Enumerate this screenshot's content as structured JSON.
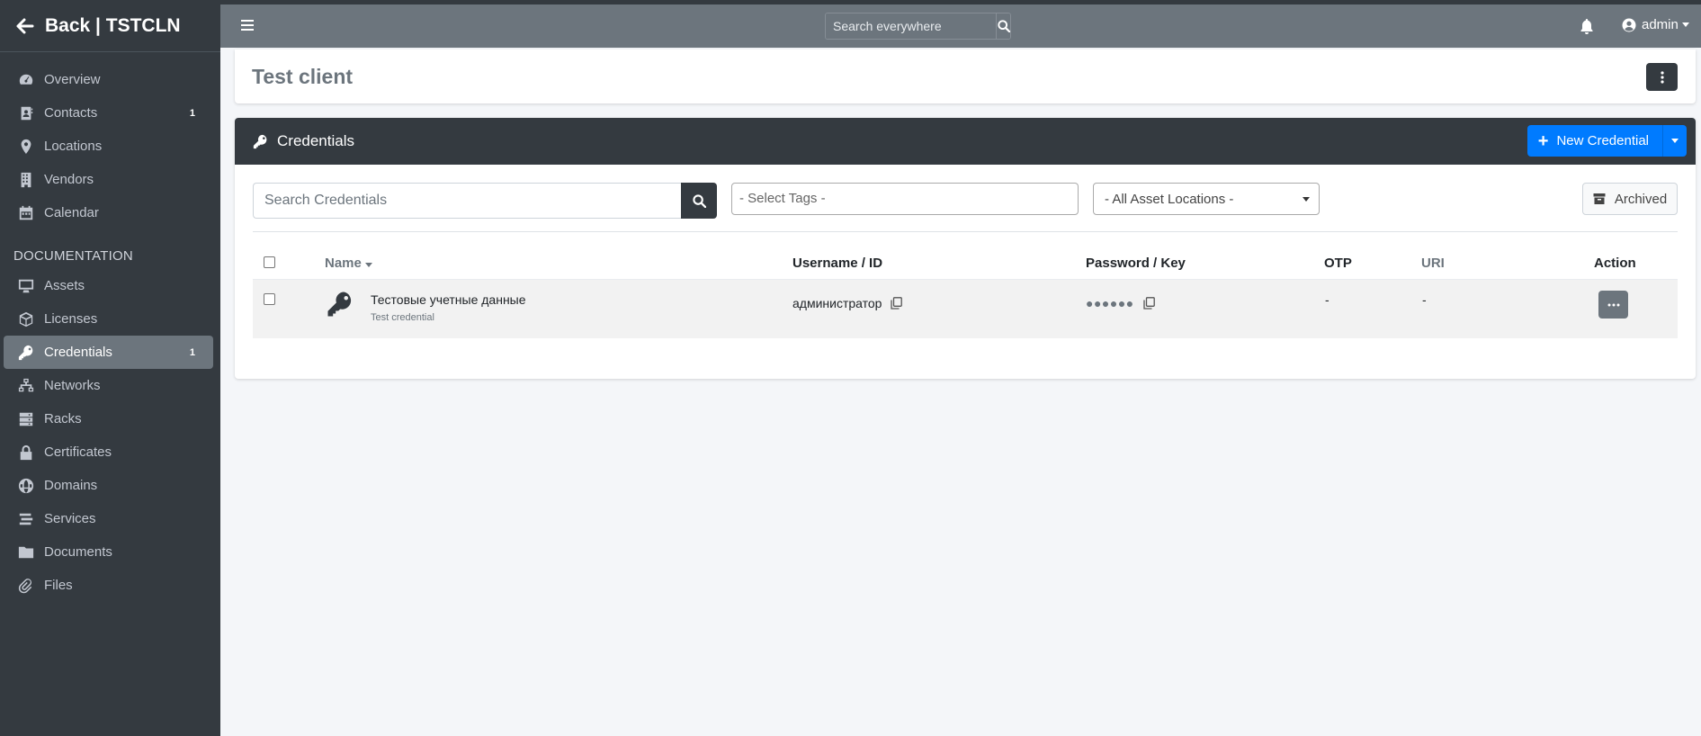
{
  "sidebar": {
    "back_label": "Back | TSTCLN",
    "items": [
      {
        "label": "Overview",
        "badge": ""
      },
      {
        "label": "Contacts",
        "badge": "1"
      },
      {
        "label": "Locations",
        "badge": ""
      },
      {
        "label": "Vendors",
        "badge": ""
      },
      {
        "label": "Calendar",
        "badge": ""
      }
    ],
    "section_header": "DOCUMENTATION",
    "doc_items": [
      {
        "label": "Assets",
        "badge": ""
      },
      {
        "label": "Licenses",
        "badge": ""
      },
      {
        "label": "Credentials",
        "badge": "1"
      },
      {
        "label": "Networks",
        "badge": ""
      },
      {
        "label": "Racks",
        "badge": ""
      },
      {
        "label": "Certificates",
        "badge": ""
      },
      {
        "label": "Domains",
        "badge": ""
      },
      {
        "label": "Services",
        "badge": ""
      },
      {
        "label": "Documents",
        "badge": ""
      },
      {
        "label": "Files",
        "badge": ""
      }
    ]
  },
  "topbar": {
    "search_placeholder": "Search everywhere",
    "user": "admin"
  },
  "client": {
    "title": "Test client"
  },
  "credentials": {
    "header": "Credentials",
    "new_button": "New Credential",
    "search_placeholder": "Search Credentials",
    "tags_placeholder": "- Select Tags -",
    "locations_selected": "- All Asset Locations -",
    "archived_label": "Archived",
    "columns": {
      "name": "Name",
      "username": "Username / ID",
      "password": "Password / Key",
      "otp": "OTP",
      "uri": "URI",
      "action": "Action"
    },
    "rows": [
      {
        "name": "Тестовые учетные данные",
        "description": "Test credential",
        "username": "администратор",
        "password_mask": "●●●●●●",
        "otp": "-",
        "uri": "-"
      }
    ]
  },
  "colors": {
    "sidebar_bg": "#343a40",
    "topbar_bg": "#6c757d",
    "accent": "#007bff",
    "active_item": "#6c757d"
  }
}
